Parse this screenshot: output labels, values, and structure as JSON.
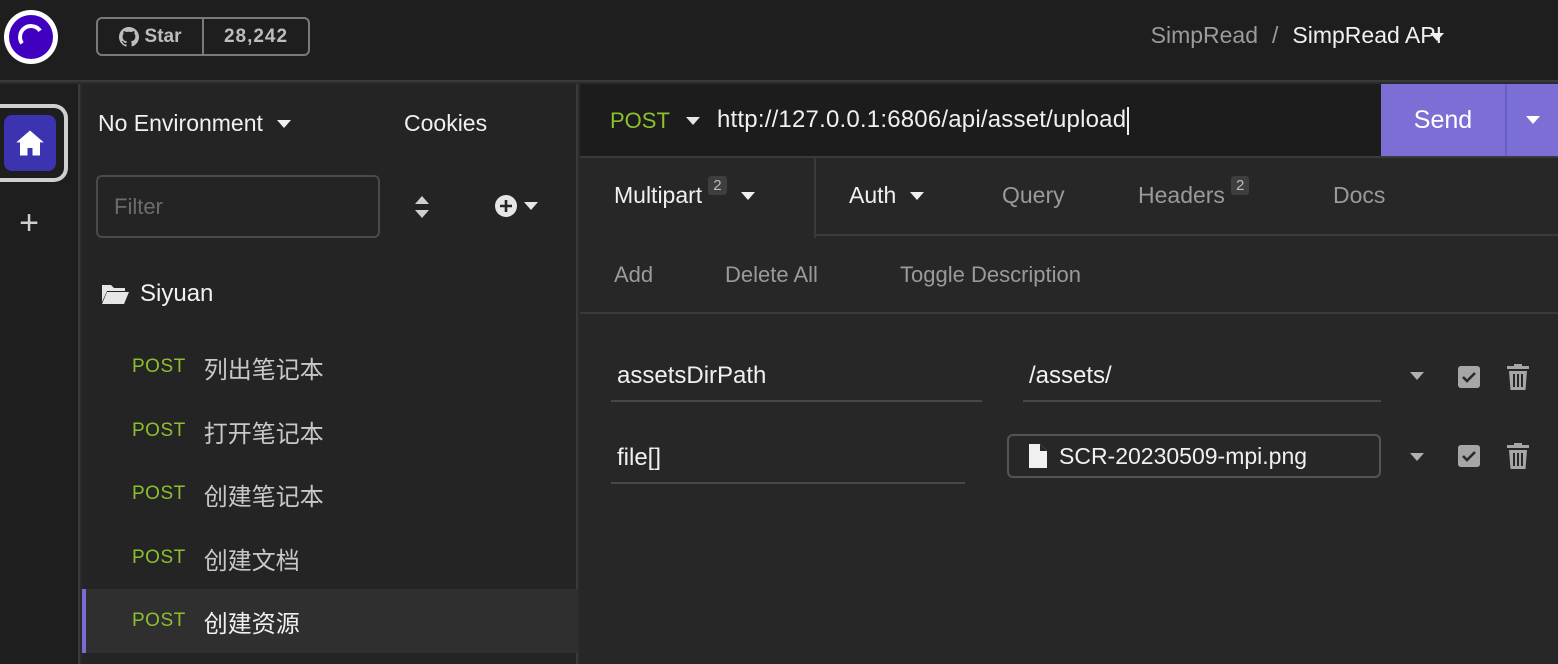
{
  "header": {
    "github_star_label": "Star",
    "github_star_count": "28,242",
    "breadcrumb_project": "SimpRead",
    "breadcrumb_sep": "/",
    "breadcrumb_collection": "SimpRead API"
  },
  "sidebar": {
    "environment": "No Environment",
    "cookies": "Cookies",
    "filter_placeholder": "Filter",
    "folder_name": "Siyuan",
    "requests": [
      {
        "method": "POST",
        "name": "列出笔记本"
      },
      {
        "method": "POST",
        "name": "打开笔记本"
      },
      {
        "method": "POST",
        "name": "创建笔记本"
      },
      {
        "method": "POST",
        "name": "创建文档"
      },
      {
        "method": "POST",
        "name": "创建资源"
      }
    ]
  },
  "request": {
    "method": "POST",
    "url": "http://127.0.0.1:6806/api/asset/upload",
    "send_label": "Send",
    "tabs": {
      "body": "Multipart",
      "body_count": "2",
      "auth": "Auth",
      "query": "Query",
      "headers": "Headers",
      "headers_count": "2",
      "docs": "Docs"
    },
    "actions": {
      "add": "Add",
      "delete_all": "Delete All",
      "toggle_description": "Toggle Description"
    },
    "params": [
      {
        "name": "assetsDirPath",
        "value": "/assets/"
      },
      {
        "name": "file[]",
        "value": "SCR-20230509-mpi.png"
      }
    ]
  },
  "colors": {
    "accent": "#7b6fd6",
    "method_post": "#8dbf2e"
  }
}
